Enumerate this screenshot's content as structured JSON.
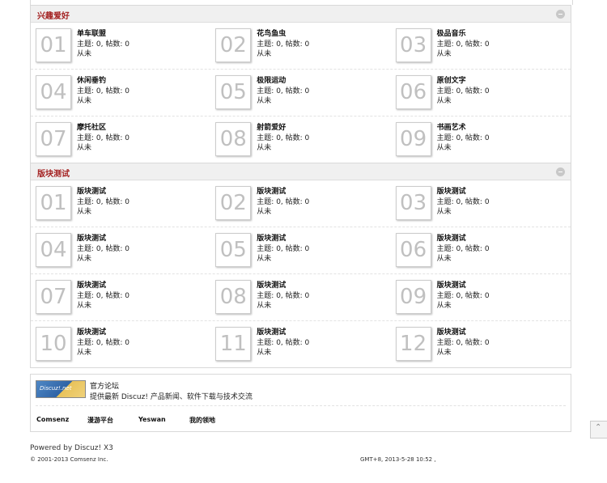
{
  "sections": [
    {
      "title": "兴趣爱好",
      "forums": [
        {
          "num": "01",
          "name": "单车联盟",
          "stats": "主题: 0, 帖数: 0",
          "last": "从未"
        },
        {
          "num": "02",
          "name": "花鸟鱼虫",
          "stats": "主题: 0, 帖数: 0",
          "last": "从未"
        },
        {
          "num": "03",
          "name": "极品音乐",
          "stats": "主题: 0, 帖数: 0",
          "last": "从未"
        },
        {
          "num": "04",
          "name": "休闲垂钓",
          "stats": "主题: 0, 帖数: 0",
          "last": "从未"
        },
        {
          "num": "05",
          "name": "极限运动",
          "stats": "主题: 0, 帖数: 0",
          "last": "从未"
        },
        {
          "num": "06",
          "name": "原创文字",
          "stats": "主题: 0, 帖数: 0",
          "last": "从未"
        },
        {
          "num": "07",
          "name": "摩托社区",
          "stats": "主题: 0, 帖数: 0",
          "last": "从未"
        },
        {
          "num": "08",
          "name": "射箭爱好",
          "stats": "主题: 0, 帖数: 0",
          "last": "从未"
        },
        {
          "num": "09",
          "name": "书画艺术",
          "stats": "主题: 0, 帖数: 0",
          "last": "从未"
        }
      ]
    },
    {
      "title": "版块测试",
      "forums": [
        {
          "num": "01",
          "name": "版块测试",
          "stats": "主题: 0, 帖数: 0",
          "last": "从未"
        },
        {
          "num": "02",
          "name": "版块测试",
          "stats": "主题: 0, 帖数: 0",
          "last": "从未"
        },
        {
          "num": "03",
          "name": "版块测试",
          "stats": "主题: 0, 帖数: 0",
          "last": "从未"
        },
        {
          "num": "04",
          "name": "版块测试",
          "stats": "主题: 0, 帖数: 0",
          "last": "从未"
        },
        {
          "num": "05",
          "name": "版块测试",
          "stats": "主题: 0, 帖数: 0",
          "last": "从未"
        },
        {
          "num": "06",
          "name": "版块测试",
          "stats": "主题: 0, 帖数: 0",
          "last": "从未"
        },
        {
          "num": "07",
          "name": "版块测试",
          "stats": "主题: 0, 帖数: 0",
          "last": "从未"
        },
        {
          "num": "08",
          "name": "版块测试",
          "stats": "主题: 0, 帖数: 0",
          "last": "从未"
        },
        {
          "num": "09",
          "name": "版块测试",
          "stats": "主题: 0, 帖数: 0",
          "last": "从未"
        },
        {
          "num": "10",
          "name": "版块测试",
          "stats": "主题: 0, 帖数: 0",
          "last": "从未"
        },
        {
          "num": "11",
          "name": "版块测试",
          "stats": "主题: 0, 帖数: 0",
          "last": "从未"
        },
        {
          "num": "12",
          "name": "版块测试",
          "stats": "主题: 0, 帖数: 0",
          "last": "从未"
        }
      ]
    }
  ],
  "friend_links": {
    "logo_text": "Discuz!.net",
    "official_title": "官方论坛",
    "official_desc": "提供最新 Discuz! 产品新闻、软件下载与技术交流",
    "links": [
      "Comsenz",
      "漫游平台",
      "Yeswan",
      "我的领地"
    ]
  },
  "footer": {
    "powered": "Powered by Discuz! X3",
    "copyright": "© 2001-2013 Comsenz Inc.",
    "time": "GMT+8, 2013-5-28 10:52 ,"
  },
  "icons": {
    "collapse": "collapse-icon",
    "scroll_top": "scroll-top-icon"
  }
}
